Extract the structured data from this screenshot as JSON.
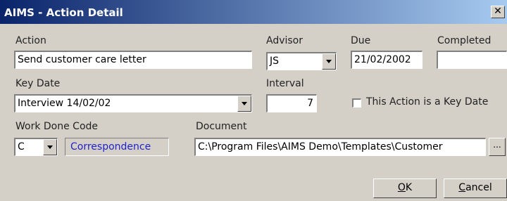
{
  "window": {
    "title": "AIMS - Action Detail",
    "close_glyph": "✕"
  },
  "fields": {
    "action": {
      "label": "Action",
      "value": "Send customer care letter"
    },
    "advisor": {
      "label": "Advisor",
      "value": "JS"
    },
    "due": {
      "label": "Due",
      "value": "21/02/2002"
    },
    "completed": {
      "label": "Completed",
      "value": ""
    },
    "key_date": {
      "label": "Key Date",
      "value": "Interview 14/02/02"
    },
    "interval": {
      "label": "Interval",
      "value": "7"
    },
    "is_key_date": {
      "label": "This Action is a Key Date",
      "checked": false
    },
    "work_done_code": {
      "label": "Work Done Code",
      "value": "C",
      "description": "Correspondence"
    },
    "document": {
      "label": "Document",
      "value": "C:\\Program Files\\AIMS Demo\\Templates\\Customer",
      "browse_label": "..."
    }
  },
  "buttons": {
    "ok": {
      "mnemonic": "O",
      "rest": "K"
    },
    "cancel": {
      "mnemonic": "C",
      "rest": "ancel"
    }
  }
}
